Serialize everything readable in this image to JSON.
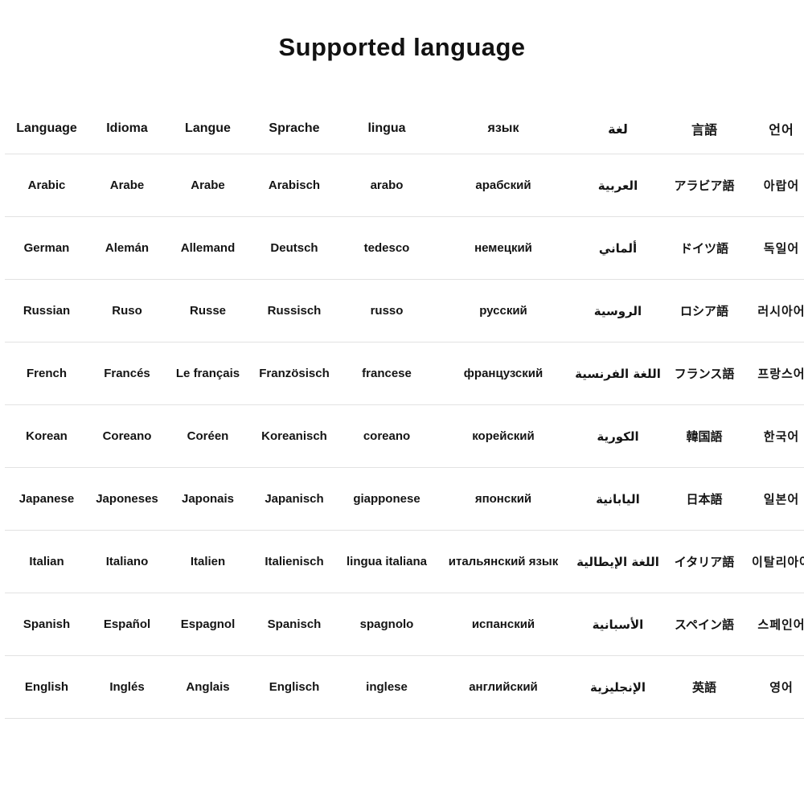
{
  "title": "Supported language",
  "table": {
    "headers": [
      "Language",
      "Idioma",
      "Langue",
      "Sprache",
      "lingua",
      "язык",
      "لغة",
      "言語",
      "언어"
    ],
    "rows": [
      {
        "en": "Arabic",
        "es": "Arabe",
        "fr": "Arabe",
        "de": "Arabisch",
        "it": "arabo",
        "ru": "арабский",
        "ar": "العربية",
        "ja": "アラビア語",
        "ko": "아랍어"
      },
      {
        "en": "German",
        "es": "Alemán",
        "fr": "Allemand",
        "de": "Deutsch",
        "it": "tedesco",
        "ru": "немецкий",
        "ar": "ألماني",
        "ja": "ドイツ語",
        "ko": "독일어"
      },
      {
        "en": "Russian",
        "es": "Ruso",
        "fr": "Russe",
        "de": "Russisch",
        "it": "russo",
        "ru": "русский",
        "ar": "الروسية",
        "ja": "ロシア語",
        "ko": "러시아어"
      },
      {
        "en": "French",
        "es": "Francés",
        "fr": "Le français",
        "de": "Französisch",
        "it": "francese",
        "ru": "французский",
        "ar": "اللغة الفرنسية",
        "ja": "フランス語",
        "ko": "프랑스어"
      },
      {
        "en": "Korean",
        "es": "Coreano",
        "fr": "Coréen",
        "de": "Koreanisch",
        "it": "coreano",
        "ru": "корейский",
        "ar": "الكورية",
        "ja": "韓国語",
        "ko": "한국어"
      },
      {
        "en": "Japanese",
        "es": "Japoneses",
        "fr": "Japonais",
        "de": "Japanisch",
        "it": "giapponese",
        "ru": "японский",
        "ar": "اليابانية",
        "ja": "日本語",
        "ko": "일본어"
      },
      {
        "en": "Italian",
        "es": "Italiano",
        "fr": "Italien",
        "de": "Italienisch",
        "it": "lingua italiana",
        "ru": "итальянский язык",
        "ar": "اللغة الإيطالية",
        "ja": "イタリア語",
        "ko": "이탈리아어"
      },
      {
        "en": "Spanish",
        "es": "Español",
        "fr": "Espagnol",
        "de": "Spanisch",
        "it": "spagnolo",
        "ru": "испанский",
        "ar": "الأسبانية",
        "ja": "スペイン語",
        "ko": "스페인어"
      },
      {
        "en": "English",
        "es": "Inglés",
        "fr": "Anglais",
        "de": "Englisch",
        "it": "inglese",
        "ru": "английский",
        "ar": "الإنجليزية",
        "ja": "英語",
        "ko": "영어"
      }
    ]
  },
  "colors": {
    "background": "#ffffff",
    "text": "#141414",
    "row_divider": "#e2e2e2"
  }
}
